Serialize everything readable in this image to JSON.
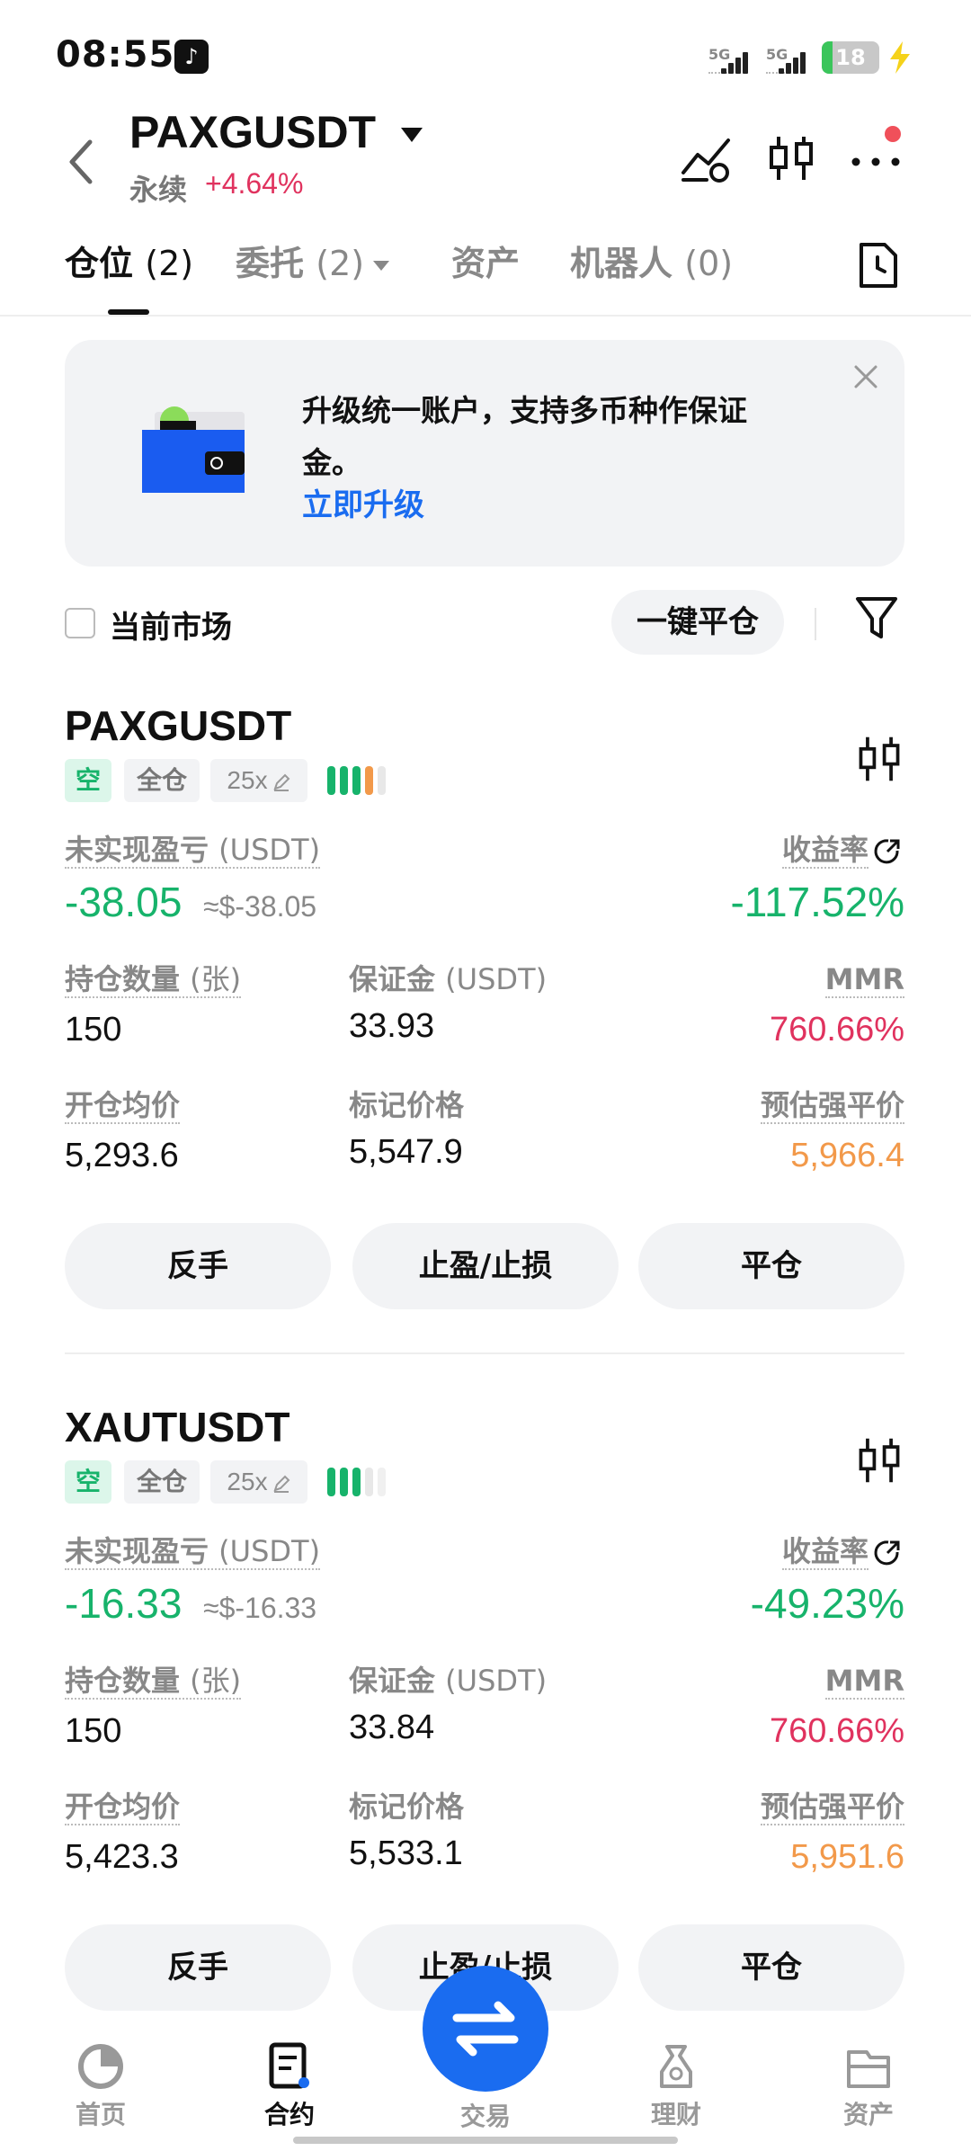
{
  "status_bar": {
    "time": "08:55",
    "signal1_label": "5G",
    "signal2_label": "5G",
    "battery": "18",
    "battery_level_percent": 18
  },
  "header": {
    "pair": "PAXGUSDT",
    "contract_type": "永续",
    "change": "+4.64%",
    "icons": [
      "back-icon",
      "caret-down-icon",
      "indicator-icon",
      "candlestick-icon",
      "more-icon"
    ]
  },
  "tabs": {
    "positions_label": "仓位",
    "positions_count": "(2)",
    "orders_label": "委托",
    "orders_count": "(2)",
    "assets_label": "资产",
    "bots_label": "机器人",
    "bots_count": "(0)"
  },
  "banner": {
    "text": "升级统一账户，支持多币种作保证金。",
    "link": "立即升级"
  },
  "filter": {
    "current_market_label": "当前市场",
    "close_all_label": "一键平仓"
  },
  "positions": [
    {
      "symbol": "PAXGUSDT",
      "side": "空",
      "margin_mode": "全仓",
      "leverage": "25x",
      "unrealized_pnl_label": "未实现盈亏",
      "unrealized_pnl_unit": "(USDT)",
      "unrealized_pnl": "-38.05",
      "unrealized_pnl_usd": "≈$-38.05",
      "roe_label": "收益率",
      "roe": "-117.52%",
      "qty_label": "持仓数量",
      "qty_unit": "(张)",
      "qty": "150",
      "margin_label": "保证金",
      "margin_unit": "(USDT)",
      "margin": "33.93",
      "mmr_label": "MMR",
      "mmr": "760.66%",
      "entry_label": "开仓均价",
      "entry": "5,293.6",
      "mark_label": "标记价格",
      "mark": "5,547.9",
      "liq_label": "预估强平价",
      "liq": "5,966.4",
      "btn_reverse": "反手",
      "btn_tpsl": "止盈/止损",
      "btn_close": "平仓"
    },
    {
      "symbol": "XAUTUSDT",
      "side": "空",
      "margin_mode": "全仓",
      "leverage": "25x",
      "unrealized_pnl_label": "未实现盈亏",
      "unrealized_pnl_unit": "(USDT)",
      "unrealized_pnl": "-16.33",
      "unrealized_pnl_usd": "≈$-16.33",
      "roe_label": "收益率",
      "roe": "-49.23%",
      "qty_label": "持仓数量",
      "qty_unit": "(张)",
      "qty": "150",
      "margin_label": "保证金",
      "margin_unit": "(USDT)",
      "margin": "33.84",
      "mmr_label": "MMR",
      "mmr": "760.66%",
      "entry_label": "开仓均价",
      "entry": "5,423.3",
      "mark_label": "标记价格",
      "mark": "5,533.1",
      "liq_label": "预估强平价",
      "liq": "5,951.6",
      "btn_reverse": "反手",
      "btn_tpsl": "止盈/止损",
      "btn_close": "平仓"
    }
  ],
  "bottom_nav": {
    "home": "首页",
    "contracts": "合约",
    "trade": "交易",
    "finance": "理财",
    "assets": "资产"
  },
  "colors": {
    "accent_blue": "#1a6cf0",
    "green": "#17b36b",
    "red": "#e0325e",
    "orange": "#f2994a"
  }
}
